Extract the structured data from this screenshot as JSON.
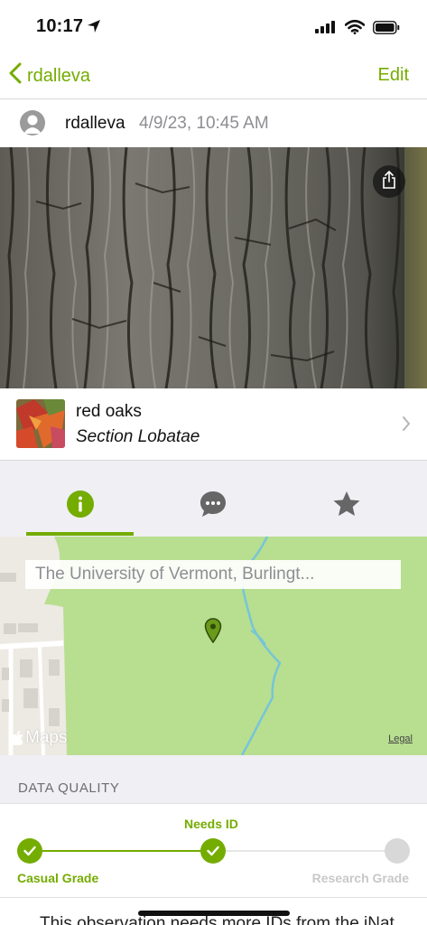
{
  "status_bar": {
    "time": "10:17",
    "location_icon": "location-arrow-icon",
    "signal_icon": "cellular-signal-icon",
    "wifi_icon": "wifi-icon",
    "battery_icon": "battery-icon"
  },
  "nav": {
    "back_label": "rdalleva",
    "edit_label": "Edit"
  },
  "observation": {
    "user": "rdalleva",
    "date": "4/9/23, 10:45 AM"
  },
  "taxon": {
    "common_name": "red oaks",
    "scientific_name": "Section Lobatae"
  },
  "tabs": [
    {
      "name": "info",
      "icon": "info-icon"
    },
    {
      "name": "activity",
      "icon": "comments-icon"
    },
    {
      "name": "favorites",
      "icon": "star-icon"
    }
  ],
  "map": {
    "place": "The University of Vermont, Burlingt...",
    "attribution": "Maps",
    "legal": "Legal"
  },
  "data_quality": {
    "title": "DATA QUALITY",
    "needs_id": "Needs ID",
    "casual": "Casual Grade",
    "research": "Research Grade"
  },
  "footer_text": "This observation needs more IDs from the iNat",
  "colors": {
    "accent": "#74ac00",
    "secondary_text": "#8e8e93",
    "gray_background": "#efeff4"
  }
}
